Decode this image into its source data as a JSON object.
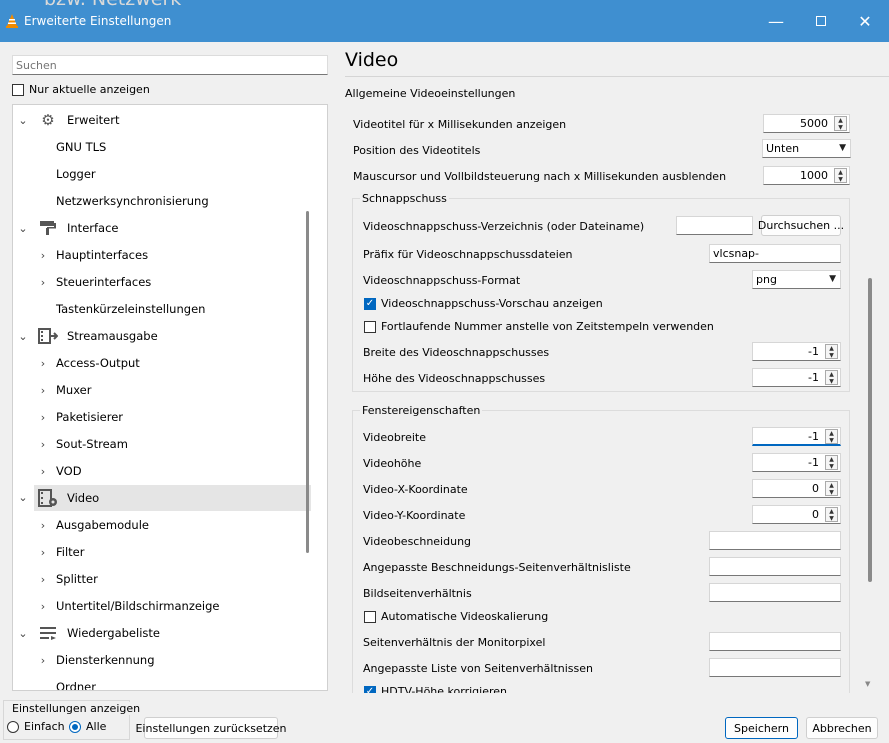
{
  "window": {
    "background_text": "bzw. Netzwerk",
    "title": "Erweiterte Einstellungen",
    "app_icon": "vlc-cone-icon",
    "accent_color": "#3f8fd0"
  },
  "left": {
    "search_placeholder": "Suchen",
    "only_current_label": "Nur aktuelle anzeigen",
    "only_current_checked": false,
    "tree": [
      {
        "label": "Erweitert",
        "level": 0,
        "expanded": true,
        "icon": "gear-icon"
      },
      {
        "label": "GNU TLS",
        "level": 1
      },
      {
        "label": "Logger",
        "level": 1
      },
      {
        "label": "Netzwerksynchronisierung",
        "level": 1
      },
      {
        "label": "Interface",
        "level": 0,
        "expanded": true,
        "icon": "paint-roller-icon"
      },
      {
        "label": "Hauptinterfaces",
        "level": 1,
        "has_children": true
      },
      {
        "label": "Steuerinterfaces",
        "level": 1,
        "has_children": true
      },
      {
        "label": "Tastenkürzeleinstellungen",
        "level": 1
      },
      {
        "label": "Streamausgabe",
        "level": 0,
        "expanded": true,
        "icon": "stream-output-icon"
      },
      {
        "label": "Access-Output",
        "level": 1,
        "has_children": true
      },
      {
        "label": "Muxer",
        "level": 1,
        "has_children": true
      },
      {
        "label": "Paketisierer",
        "level": 1,
        "has_children": true
      },
      {
        "label": "Sout-Stream",
        "level": 1,
        "has_children": true
      },
      {
        "label": "VOD",
        "level": 1,
        "has_children": true
      },
      {
        "label": "Video",
        "level": 0,
        "expanded": true,
        "icon": "video-settings-icon",
        "selected": true
      },
      {
        "label": "Ausgabemodule",
        "level": 1,
        "has_children": true
      },
      {
        "label": "Filter",
        "level": 1,
        "has_children": true
      },
      {
        "label": "Splitter",
        "level": 1,
        "has_children": true
      },
      {
        "label": "Untertitel/Bildschirmanzeige",
        "level": 1,
        "has_children": true
      },
      {
        "label": "Wiedergabeliste",
        "level": 0,
        "expanded": true,
        "icon": "playlist-icon"
      },
      {
        "label": "Diensterkennung",
        "level": 1,
        "has_children": true
      },
      {
        "label": "Ordner",
        "level": 1
      }
    ],
    "settings_mode": {
      "title": "Einstellungen anzeigen",
      "simple": "Einfach",
      "all": "Alle",
      "selected": "all"
    },
    "reset_button": "Einstellungen zurücksetzen"
  },
  "right": {
    "title": "Video",
    "subtitle": "Allgemeine Videoeinstellungen",
    "title_duration_label": "Videotitel für x Millisekunden anzeigen",
    "title_duration_value": "5000",
    "title_position_label": "Position des Videotitels",
    "title_position_value": "Unten",
    "mouse_hide_label": "Mauscursor und Vollbildsteuerung nach x Millisekunden ausblenden",
    "mouse_hide_value": "1000",
    "snapshot": {
      "group_title": "Schnappschuss",
      "dir_label": "Videoschnappschuss-Verzeichnis (oder Dateiname)",
      "dir_value": "",
      "browse_button": "Durchsuchen ...",
      "prefix_label": "Präfix für Videoschnappschussdateien",
      "prefix_value": "vlcsnap-",
      "format_label": "Videoschnappschuss-Format",
      "format_value": "png",
      "preview_label": "Videoschnappschuss-Vorschau anzeigen",
      "preview_checked": true,
      "sequential_label": "Fortlaufende Nummer anstelle von Zeitstempeln verwenden",
      "sequential_checked": false,
      "width_label": "Breite des Videoschnappschusses",
      "width_value": "-1",
      "height_label": "Höhe des Videoschnappschusses",
      "height_value": "-1"
    },
    "window_props": {
      "group_title": "Fenstereigenschaften",
      "width_label": "Videobreite",
      "width_value": "-1",
      "height_label": "Videohöhe",
      "height_value": "-1",
      "x_label": "Video-X-Koordinate",
      "x_value": "0",
      "y_label": "Video-Y-Koordinate",
      "y_value": "0",
      "crop_label": "Videobeschneidung",
      "crop_value": "",
      "custom_crop_label": "Angepasste Beschneidungs-Seitenverhältnisliste",
      "custom_crop_value": "",
      "aspect_label": "Bildseitenverhältnis",
      "aspect_value": "",
      "autoscale_label": "Automatische Videoskalierung",
      "autoscale_checked": false,
      "monitor_par_label": "Seitenverhältnis der Monitorpixel",
      "monitor_par_value": "",
      "custom_aspect_label": "Angepasste Liste von Seitenverhältnissen",
      "custom_aspect_value": "",
      "hdtv_label": "HDTV-Höhe korrigieren",
      "hdtv_checked": true
    }
  },
  "buttons": {
    "save": "Speichern",
    "cancel": "Abbrechen"
  }
}
